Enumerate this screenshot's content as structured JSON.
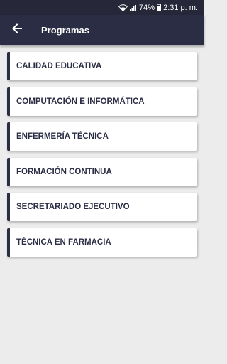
{
  "status_bar": {
    "battery": "74%",
    "time": "2:31 p. m."
  },
  "header": {
    "title": "Programas"
  },
  "programs": [
    {
      "label": "CALIDAD EDUCATIVA"
    },
    {
      "label": "COMPUTACIÓN E INFORMÁTICA"
    },
    {
      "label": "ENFERMERÍA TÉCNICA"
    },
    {
      "label": "FORMACIÓN CONTINUA"
    },
    {
      "label": "SECRETARIADO EJECUTIVO"
    },
    {
      "label": "TÉCNICA EN FARMACIA"
    }
  ],
  "colors": {
    "primary": "#2b2d45",
    "status_bar": "#262839",
    "background": "#ececec"
  },
  "icons": [
    "wifi-icon",
    "signal-icon",
    "battery-icon",
    "back-arrow-icon"
  ]
}
